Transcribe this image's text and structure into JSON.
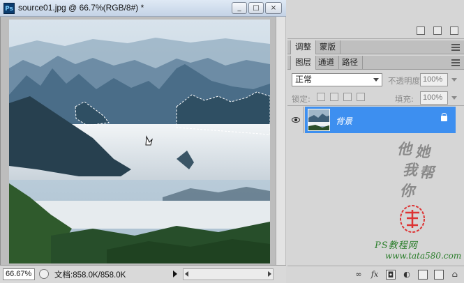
{
  "document": {
    "app_icon": "Ps",
    "title": "source01.jpg @ 66.7%(RGB/8#) *",
    "window_buttons": [
      "_",
      "□",
      "×"
    ]
  },
  "statusbar": {
    "zoom": "66.67%",
    "doc_info": "文档:858.0K/858.0K"
  },
  "panel_top": {
    "tabs": [
      "调整",
      "蒙版"
    ]
  },
  "layers_panel": {
    "tabs": [
      "图层",
      "通道",
      "路径"
    ],
    "blend_mode": "正常",
    "opacity_label": "不透明度:",
    "opacity_value": "100%",
    "lock_label": "锁定:",
    "fill_label": "填充:",
    "fill_value": "100%",
    "layers": [
      {
        "name": "背景",
        "visible": true,
        "locked": true
      }
    ],
    "footer_icons": [
      "link-icon",
      "fx-icon",
      "mask-icon",
      "adjustment-icon",
      "folder-icon",
      "new-layer-icon",
      "trash-icon"
    ],
    "footer_fx": "fx"
  },
  "watermark": {
    "chars": [
      "他",
      "她",
      "我",
      "帮",
      "你"
    ],
    "caption": "PS教程网",
    "url": "www.tata580.com"
  },
  "colors": {
    "selection": "#3d8ff0",
    "panel_bg": "#d6d6d6",
    "titlebar": "#c4d3e6"
  }
}
